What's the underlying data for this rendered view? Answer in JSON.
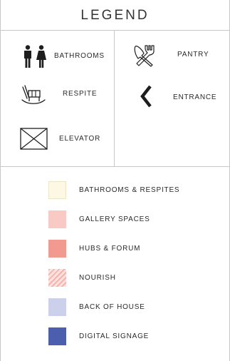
{
  "title": "LEGEND",
  "icons": [
    {
      "key": "bathrooms",
      "label": "BATHROOMS",
      "icon": "restroom-icon"
    },
    {
      "key": "pantry",
      "label": "PANTRY",
      "icon": "fork-knife-icon"
    },
    {
      "key": "respite",
      "label": "RESPITE",
      "icon": "rocking-chair-icon"
    },
    {
      "key": "entrance",
      "label": "ENTRANCE",
      "icon": "chevron-left-icon"
    },
    {
      "key": "elevator",
      "label": "ELEVATOR",
      "icon": "elevator-icon"
    }
  ],
  "swatches": [
    {
      "label": "BATHROOMS & RESPITES",
      "color": "#fdf8e3",
      "pattern": "solid"
    },
    {
      "label": "GALLERY SPACES",
      "color": "#f9c9c4",
      "pattern": "solid"
    },
    {
      "label": "HUBS & FORUM",
      "color": "#f29a90",
      "pattern": "solid"
    },
    {
      "label": "NOURISH",
      "color": "#f6b3ae",
      "pattern": "hatched"
    },
    {
      "label": "BACK OF HOUSE",
      "color": "#cdd0ea",
      "pattern": "solid"
    },
    {
      "label": "DIGITAL SIGNAGE",
      "color": "#4c5eae",
      "pattern": "solid"
    }
  ]
}
